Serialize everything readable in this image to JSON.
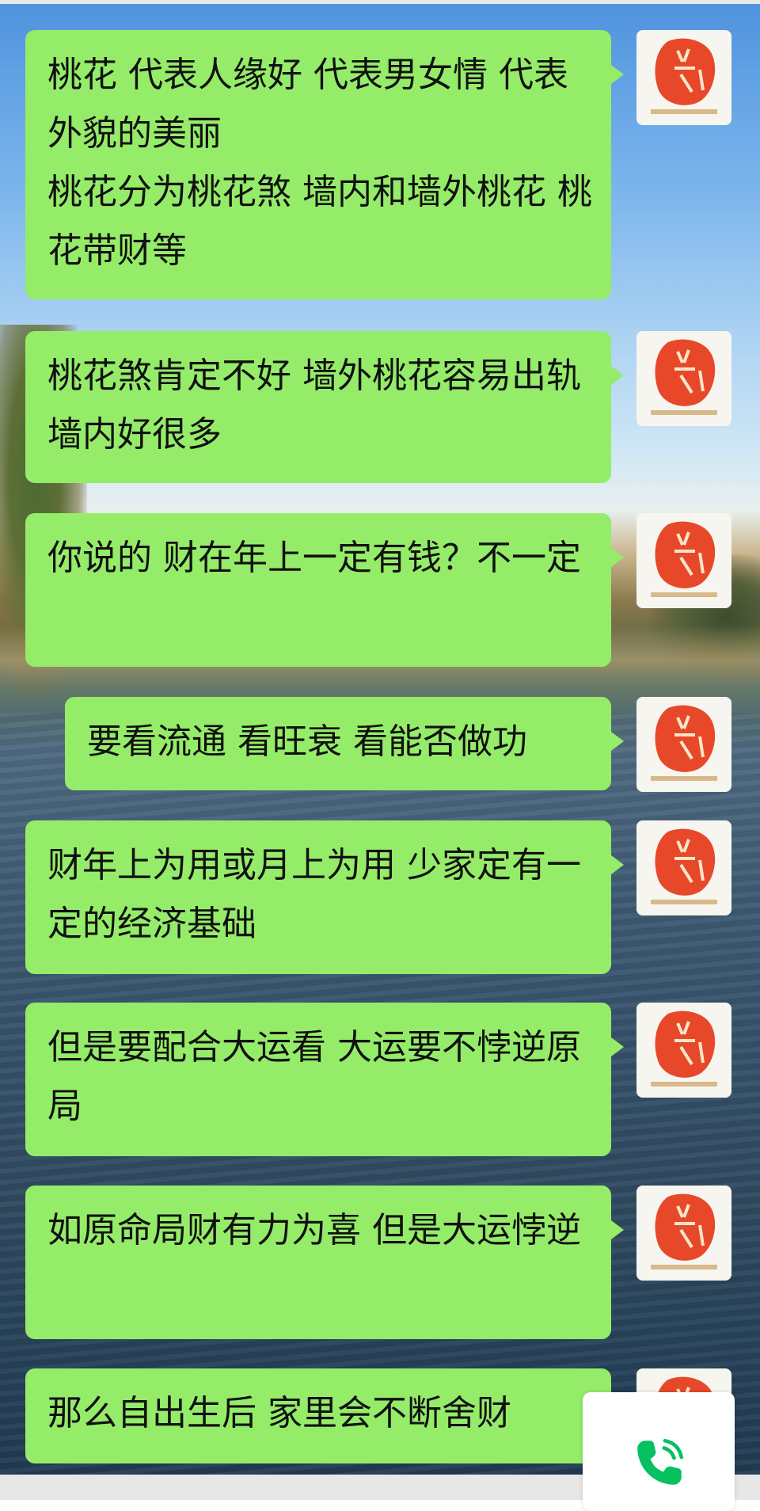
{
  "chat": {
    "messages": [
      {
        "text": "桃花 代表人缘好 代表男女情 代表外貌的美丽\n桃花分为桃花煞 墙内和墙外桃花 桃花带财等"
      },
      {
        "text": "桃花煞肯定不好 墙外桃花容易出轨 墙内好很多"
      },
      {
        "text": "你说的 财在年上一定有钱？不一定"
      },
      {
        "text": "要看流通 看旺衰 看能否做功"
      },
      {
        "text": "财年上为用或月上为用 少家定有一定的经济基础"
      },
      {
        "text": "但是要配合大运看 大运要不悖逆原局"
      },
      {
        "text": "如原命局财有力为喜 但是大运悖逆"
      },
      {
        "text": "那么自出生后 家里会不断舍财"
      }
    ],
    "avatar_icon": "red-seal-logo-icon",
    "call_button_icon": "phone-call-icon"
  },
  "colors": {
    "bubble": "#95ec69",
    "accent_green": "#07c160"
  }
}
